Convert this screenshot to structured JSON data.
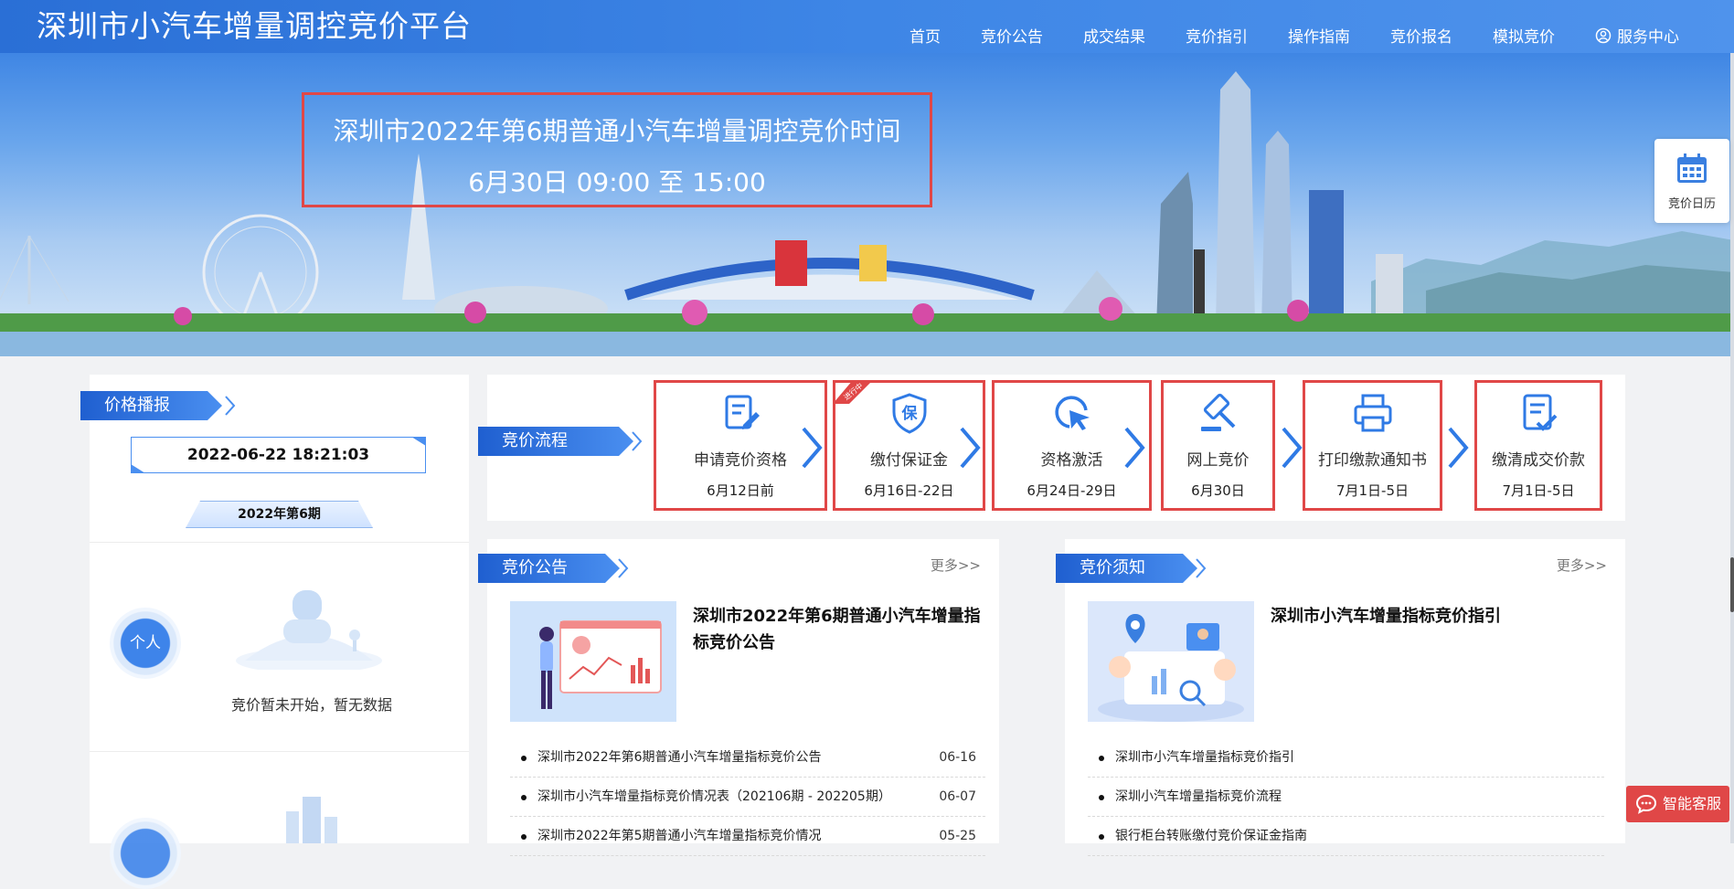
{
  "header": {
    "title": "深圳市小汽车增量调控竞价平台",
    "nav": [
      {
        "label": "首页"
      },
      {
        "label": "竞价公告"
      },
      {
        "label": "成交结果"
      },
      {
        "label": "竞价指引"
      },
      {
        "label": "操作指南"
      },
      {
        "label": "竞价报名"
      },
      {
        "label": "模拟竞价"
      },
      {
        "label": "服务中心",
        "icon": "user-circle-icon"
      }
    ]
  },
  "banner": {
    "line1": "深圳市2022年第6期普通小汽车增量调控竞价时间",
    "line2": "6月30日 09:00 至 15:00"
  },
  "calendar_widget": {
    "label": "竞价日历",
    "icon": "calendar-icon"
  },
  "price_broadcast": {
    "title": "价格播报",
    "datetime": "2022-06-22 18:21:03",
    "period": "2022年第6期",
    "personal_label": "个人",
    "empty_message": "竞价暂未开始，暂无数据"
  },
  "process": {
    "title": "竞价流程",
    "steps": [
      {
        "name": "申请竞价资格",
        "date": "6月12日前",
        "icon": "edit-document-icon"
      },
      {
        "name": "缴付保证金",
        "date": "6月16日-22日",
        "icon": "shield-icon",
        "shield_char": "保",
        "badge": "进行中"
      },
      {
        "name": "资格激活",
        "date": "6月24日-29日",
        "icon": "cursor-click-icon"
      },
      {
        "name": "网上竞价",
        "date": "6月30日",
        "icon": "gavel-icon"
      },
      {
        "name": "打印缴款通知书",
        "date": "7月1日-5日",
        "icon": "printer-icon"
      },
      {
        "name": "缴清成交价款",
        "date": "7月1日-5日",
        "icon": "checklist-icon"
      }
    ]
  },
  "announcements": {
    "title": "竞价公告",
    "more": "更多>>",
    "feature_title": "深圳市2022年第6期普通小汽车增量指标竞价公告",
    "items": [
      {
        "text": "深圳市2022年第6期普通小汽车增量指标竞价公告",
        "date": "06-16"
      },
      {
        "text": "深圳市小汽车增量指标竞价情况表（202106期 - 202205期）",
        "date": "06-07"
      },
      {
        "text": "深圳市2022年第5期普通小汽车增量指标竞价情况",
        "date": "05-25"
      }
    ]
  },
  "notice": {
    "title": "竞价须知",
    "more": "更多>>",
    "feature_title": "深圳市小汽车增量指标竞价指引",
    "items": [
      {
        "text": "深圳市小汽车增量指标竞价指引"
      },
      {
        "text": "深圳小汽车增量指标竞价流程"
      },
      {
        "text": "银行柜台转账缴付竞价保证金指南"
      }
    ]
  },
  "chat": {
    "label": "智能客服",
    "icon": "chat-bubble-icon"
  },
  "colors": {
    "primary": "#3a7fe0",
    "highlight_border": "#e04747",
    "chat": "#e04747"
  }
}
